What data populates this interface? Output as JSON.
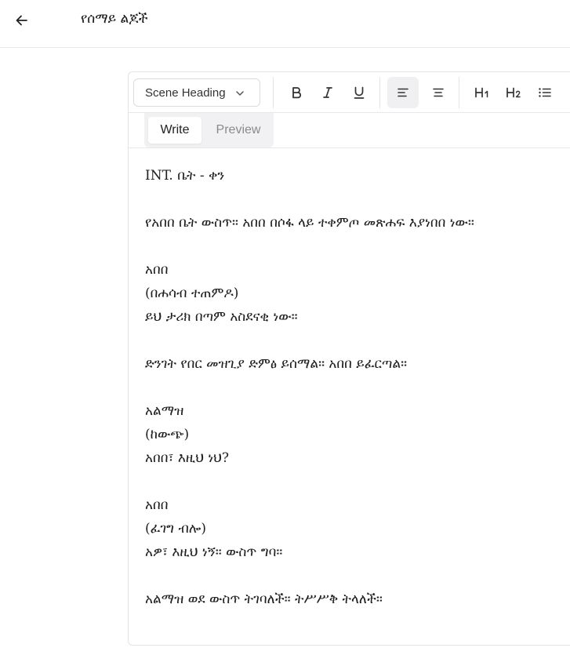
{
  "header": {
    "title": "የሰማይ ልጆች"
  },
  "toolbar": {
    "block_type": "Scene Heading",
    "buttons": [
      {
        "name": "bold",
        "icon": "bold-icon"
      },
      {
        "name": "italic",
        "icon": "italic-icon"
      },
      {
        "name": "underline",
        "icon": "underline-icon"
      },
      {
        "name": "align-left",
        "icon": "align-left-icon",
        "active": true
      },
      {
        "name": "align-center",
        "icon": "align-center-icon"
      },
      {
        "name": "heading-1",
        "icon": "heading-1-icon"
      },
      {
        "name": "heading-2",
        "icon": "heading-2-icon"
      },
      {
        "name": "bullet-list",
        "icon": "bullet-list-icon"
      }
    ]
  },
  "tabs": {
    "write": "Write",
    "preview": "Preview",
    "active": "write"
  },
  "content": {
    "lines": [
      "INT. ቤት - ቀን",
      "",
      "የአበበ ቤት ውስጥ። አበበ በሶፋ ላይ ተቀምጦ መጽሐፍ እያነበበ ነው።",
      "",
      "አበበ",
      "(በሐሳብ ተጠምዶ)",
      "ይህ ታሪክ በጣም አስደናቂ ነው።",
      "",
      "ድንገት የበር መዝጊያ ድምፅ ይሰማል። አበበ ይፈርጣል።",
      "",
      "አልማዝ",
      "(ከውጭ)",
      "አበበ፣ እዚህ ነህ?",
      "",
      "አበበ",
      "(ፈገግ ብሎ)",
      "አዎ፣ እዚህ ነኝ። ውስጥ ግባ።",
      "",
      "አልማዝ ወደ ውስጥ ትገባለች። ትሥሥቅ ትላለች።"
    ]
  }
}
